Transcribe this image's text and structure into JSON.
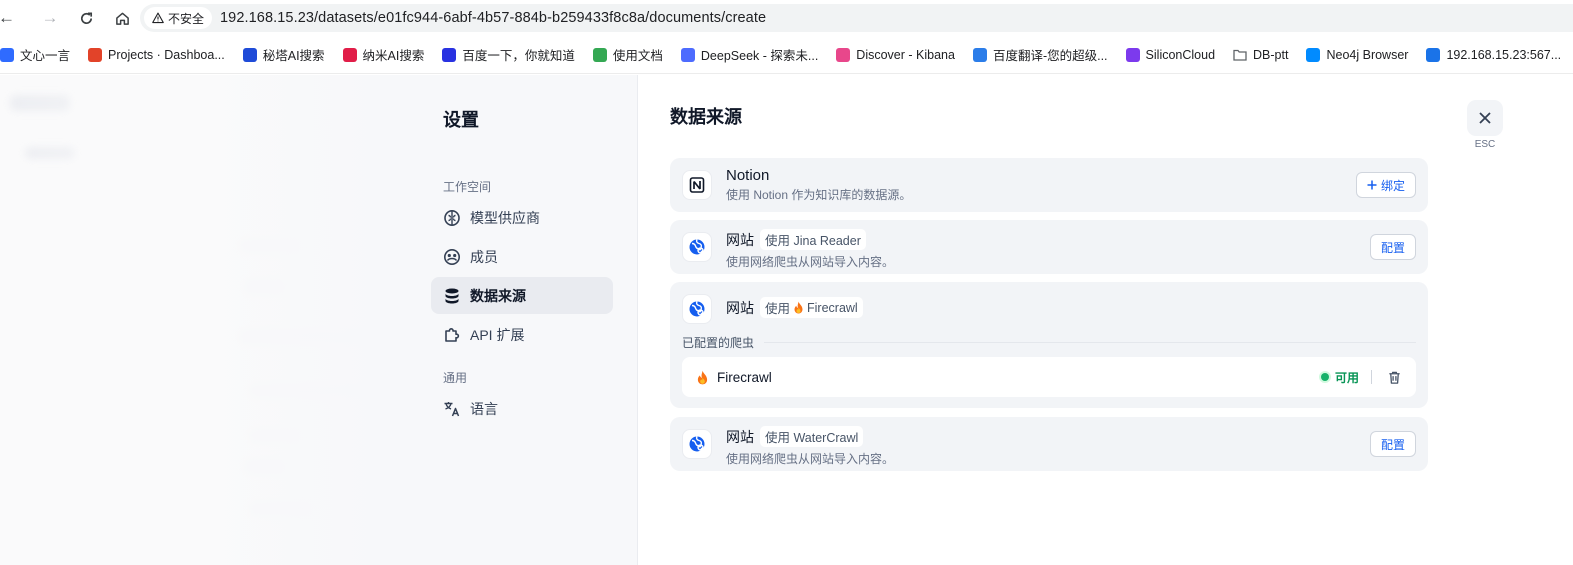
{
  "browser": {
    "insecure_label": "不安全",
    "url": "192.168.15.23/datasets/e01fc944-6abf-4b57-884b-b259433f8c8a/documents/create",
    "bookmarks": [
      {
        "label": "文心一言",
        "icon": "wenxin-icon",
        "color": "#2f6bff"
      },
      {
        "label": "Projects · Dashboa...",
        "icon": "gitlab-icon",
        "color": "#e24329"
      },
      {
        "label": "秘塔AI搜索",
        "icon": "metaso-icon",
        "color": "#1f4bd8"
      },
      {
        "label": "纳米AI搜索",
        "icon": "nami-icon",
        "color": "#e11d48"
      },
      {
        "label": "百度一下，你就知道",
        "icon": "baidu-icon",
        "color": "#2932e1"
      },
      {
        "label": "使用文档",
        "icon": "doc-leaf-icon",
        "color": "#34a853"
      },
      {
        "label": "DeepSeek - 探索未...",
        "icon": "deepseek-icon",
        "color": "#4d6bfe"
      },
      {
        "label": "Discover - Kibana",
        "icon": "kibana-icon",
        "color": "#e8478b"
      },
      {
        "label": "百度翻译-您的超级...",
        "icon": "translate-icon",
        "color": "#2b7de9"
      },
      {
        "label": "SiliconCloud",
        "icon": "siliconcloud-icon",
        "color": "#7c3aed"
      },
      {
        "label": "DB-ptt",
        "icon": "folder-icon",
        "color": "#5f6368"
      },
      {
        "label": "Neo4j Browser",
        "icon": "neo4j-icon",
        "color": "#018bff"
      },
      {
        "label": "192.168.15.23:567...",
        "icon": "site-icon",
        "color": "#1a73e8"
      }
    ]
  },
  "settings": {
    "title": "设置",
    "groups": {
      "workspace": "工作空间",
      "general": "通用"
    },
    "menu": [
      {
        "label": "模型供应商",
        "icon": "brain-icon",
        "active": false
      },
      {
        "label": "成员",
        "icon": "members-icon",
        "active": false
      },
      {
        "label": "数据来源",
        "icon": "database-icon",
        "active": true
      },
      {
        "label": "API 扩展",
        "icon": "puzzle-icon",
        "active": false
      },
      {
        "label": "语言",
        "icon": "translate-icon",
        "active": false
      }
    ],
    "close_hint": "ESC"
  },
  "data_sources": {
    "title": "数据来源",
    "notion": {
      "name": "Notion",
      "desc": "使用 Notion 作为知识库的数据源。",
      "button": "绑定"
    },
    "jina": {
      "name": "网站",
      "tag": "使用 Jina Reader",
      "desc": "使用网络爬虫从网站导入内容。",
      "button": "配置"
    },
    "firecrawl": {
      "name": "网站",
      "tag_prefix": "使用",
      "tag_name": "Firecrawl",
      "configured_label": "已配置的爬虫",
      "crawler_name": "Firecrawl",
      "status": "可用"
    },
    "watercrawl": {
      "name": "网站",
      "tag": "使用 WaterCrawl",
      "desc": "使用网络爬虫从网站导入内容。",
      "button": "配置"
    }
  }
}
